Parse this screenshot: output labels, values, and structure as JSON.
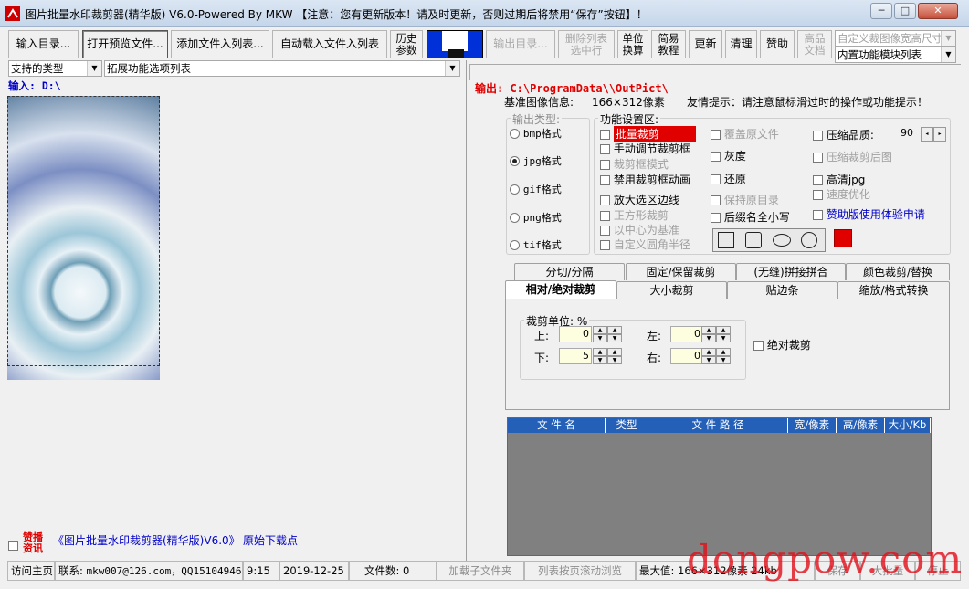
{
  "title": {
    "text": "图片批量水印裁剪器(精华版) V6.0-Powered By MKW 【注意：您有更新版本！请及时更新，否则过期后将禁用“保存”按钮】！",
    "min": "─",
    "max": "□",
    "close": "✕"
  },
  "toolbar": {
    "input_dir": "输入目录...",
    "open_preview": "打开预览文件...",
    "add_files": "添加文件入列表...",
    "auto_load": "自动载入文件入列表",
    "history_1": "历史",
    "history_2": "参数",
    "output_dir": "输出目录...",
    "delete_1": "删除列表",
    "delete_2": "选中行",
    "unit_1": "单位",
    "unit_2": "换算",
    "tutorial_1": "简易",
    "tutorial_2": "教程",
    "update": "更新",
    "clear": "清理",
    "donate": "赞助",
    "hd_1": "高品",
    "hd_2": "文档",
    "custom_combo": "自定义裁图像宽高尺寸",
    "module_combo": "内置功能模块列表"
  },
  "filters": {
    "type_combo": "支持的类型",
    "ext_combo": "拓展功能选项列表"
  },
  "input": {
    "label": "输入: D:\\"
  },
  "output": {
    "label": "输出: C:\\ProgramData\\\\OutPict\\",
    "base_info": "基准图像信息:",
    "size_text": "166×312像素",
    "tip": "友情提示：请注意鼠标滑过时的操作或功能提示！"
  },
  "output_type": {
    "legend": "输出类型:",
    "bmp": "bmp格式",
    "jpg": "jpg格式",
    "gif": "gif格式",
    "png": "png格式",
    "tif": "tif格式"
  },
  "settings": {
    "legend": "功能设置区:",
    "c1": [
      "批量裁剪",
      "手动调节裁剪框",
      "裁剪框模式",
      "禁用裁剪框动画",
      "放大选区边线",
      "正方形裁剪",
      "以中心为基准",
      "自定义圆角半径"
    ],
    "c2": [
      "覆盖原文件",
      "灰度",
      "还原",
      "保持原目录",
      "后缀名全小写"
    ],
    "c3": [
      "压缩品质:",
      "压缩裁剪后图",
      "高清jpg",
      "速度优化",
      "赞助版使用体验申请"
    ],
    "quality": "90"
  },
  "tabs": {
    "row1": [
      "分切/分隔",
      "固定/保留裁剪",
      "(无缝)拼接拼合",
      "颜色裁剪/替换"
    ],
    "row2": [
      "相对/绝对裁剪",
      "大小裁剪",
      "贴边条",
      "缩放/格式转换"
    ]
  },
  "crop": {
    "legend": "裁剪单位: %",
    "top": "上:",
    "bottom": "下:",
    "left": "左:",
    "right": "右:",
    "top_val": "0",
    "bottom_val": "5",
    "left_val": "0",
    "right_val": "0",
    "absolute": "绝对裁剪"
  },
  "grid": {
    "headers": [
      "文 件 名",
      "类型",
      "文 件 路 径",
      "宽/像素",
      "高/像素",
      "大小/Kb"
    ]
  },
  "promo": {
    "badge_1": "赞播",
    "badge_2": "资讯",
    "text": "《图片批量水印裁剪器(精华版)V6.0》",
    "link": "原始下载点"
  },
  "status": {
    "home": "访问主页",
    "contact_label": "联系:",
    "contact": "mkw007@126.com，QQ15104946",
    "time": "9:15",
    "date": "2019-12-25",
    "file_count": "文件数: 0",
    "load_sub": "加载子文件夹",
    "list_scroll": "列表按页滚动浏览",
    "max": "最大值: 166×312像素 24kb",
    "save": "保存",
    "batch": "大批量",
    "stop": "停止"
  },
  "watermark": "dongpow.com",
  "colors": {
    "red": "#e00000",
    "blue": "#0000c8",
    "accent": "#2460b8"
  }
}
